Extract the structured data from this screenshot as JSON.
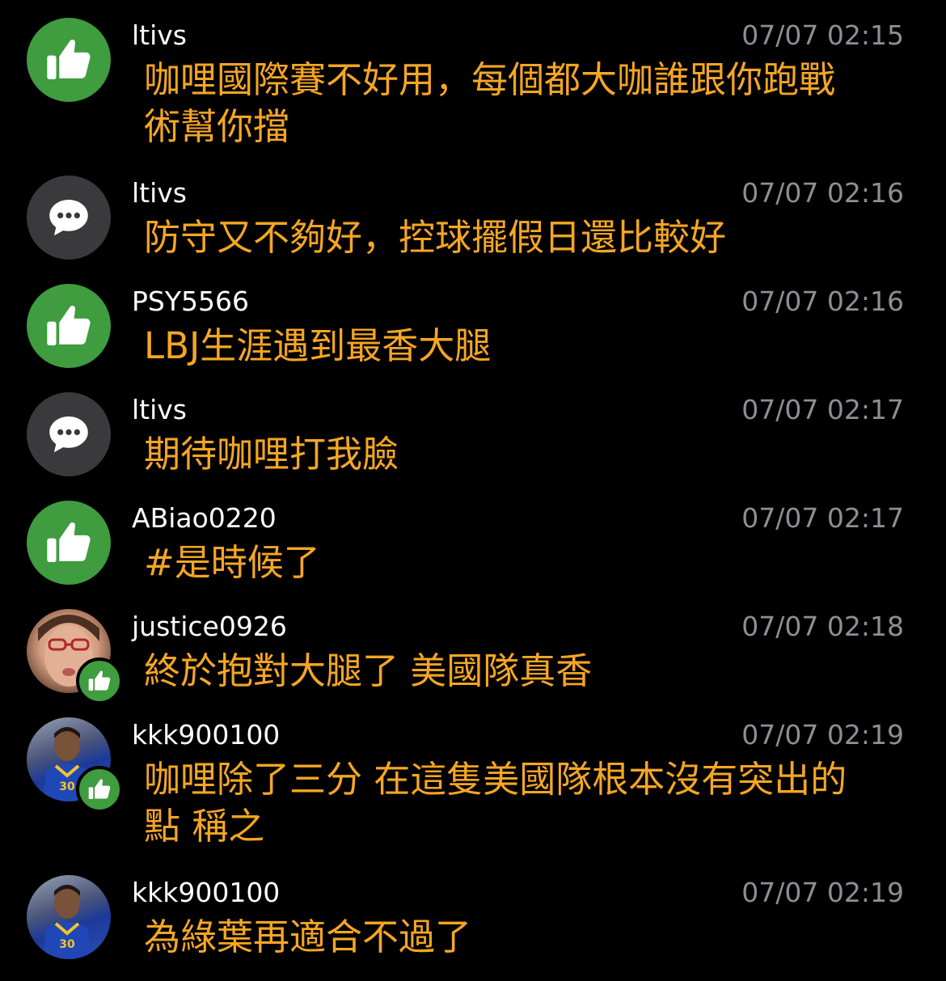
{
  "comments": [
    {
      "type": "push",
      "user": "ltivs",
      "time": "07/07 02:15",
      "text": "咖哩國際賽不好用，每個都大咖誰跟你跑戰術幫你擋"
    },
    {
      "type": "neutral",
      "user": "ltivs",
      "time": "07/07 02:16",
      "text": "防守又不夠好，控球擺假日還比較好"
    },
    {
      "type": "push",
      "user": "PSY5566",
      "time": "07/07 02:16",
      "text": "LBJ生涯遇到最香大腿"
    },
    {
      "type": "neutral",
      "user": "ltivs",
      "time": "07/07 02:17",
      "text": "期待咖哩打我臉"
    },
    {
      "type": "push",
      "user": "ABiao0220",
      "time": "07/07 02:17",
      "text": "#是時候了"
    },
    {
      "type": "push",
      "user": "justice0926",
      "time": "07/07 02:18",
      "text": "終於抱對大腿了 美國隊真香"
    },
    {
      "type": "push",
      "user": "kkk900100",
      "time": "07/07 02:19",
      "text": "咖哩除了三分 在這隻美國隊根本沒有突出的點 稱之"
    },
    {
      "type": "neutral",
      "user": "kkk900100",
      "time": "07/07 02:19",
      "text": "為綠葉再適合不過了"
    }
  ],
  "icons": {
    "push": "thumbs-up-icon",
    "neutral": "speech-bubble-icon"
  },
  "colors": {
    "background": "#000000",
    "username": "#ffffff",
    "timestamp": "#8e8e93",
    "message": "#f5a623",
    "push_green": "#3f9c3f",
    "neutral_gray": "#3a3a3c"
  }
}
